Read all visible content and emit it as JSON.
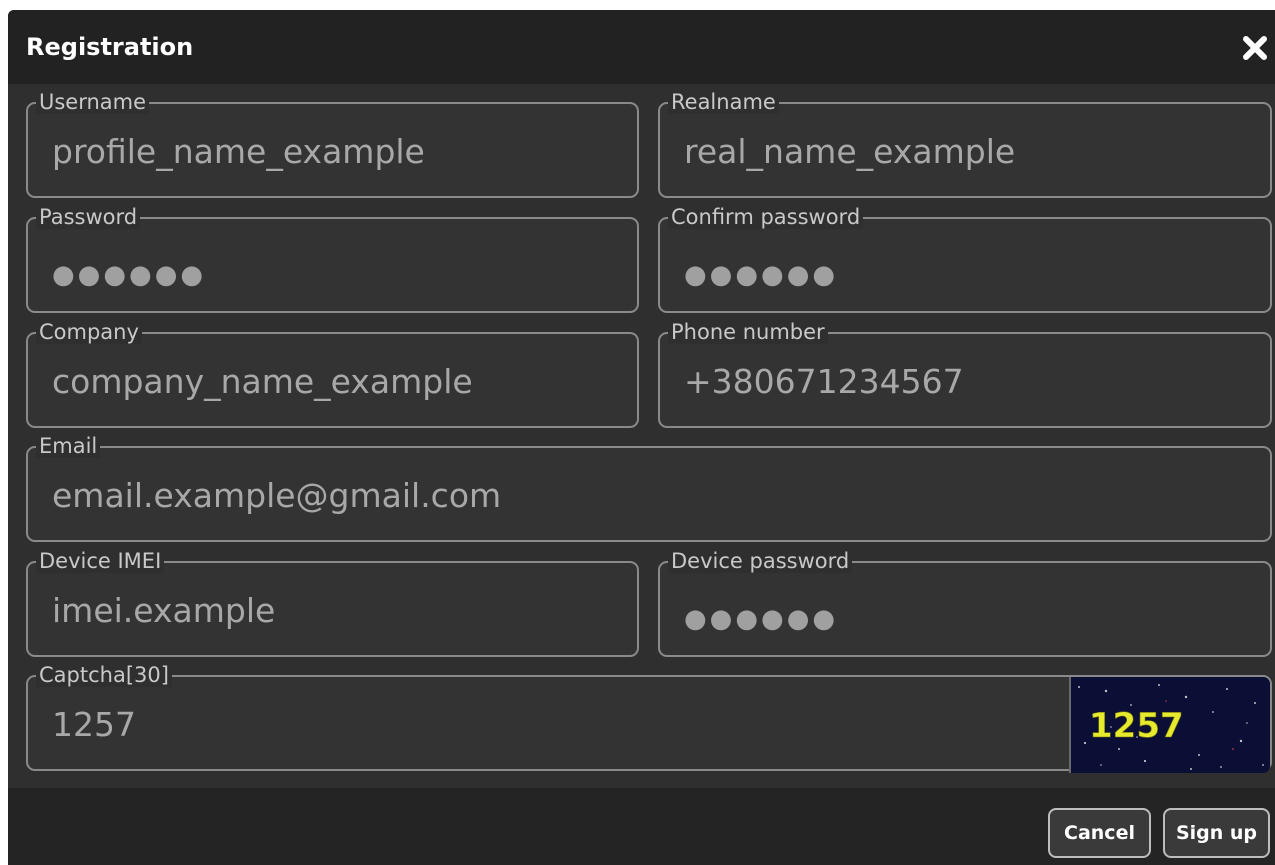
{
  "dialog": {
    "title": "Registration",
    "close_icon": "close-icon"
  },
  "fields": {
    "username": {
      "label": "Username",
      "value": "profile_name_example"
    },
    "realname": {
      "label": "Realname",
      "value": "real_name_example"
    },
    "password": {
      "label": "Password",
      "value": "●●●●●●"
    },
    "confirm_password": {
      "label": "Confirm password",
      "value": "●●●●●●"
    },
    "company": {
      "label": "Company",
      "value": "company_name_example"
    },
    "phone": {
      "label": "Phone number",
      "value": "+380671234567"
    },
    "email": {
      "label": "Email",
      "value": "email.example@gmail.com"
    },
    "imei": {
      "label": "Device IMEI",
      "value": "imei.example"
    },
    "device_password": {
      "label": "Device password",
      "value": "●●●●●●"
    },
    "captcha": {
      "label": "Captcha[30]",
      "value": "1257",
      "image_text": "1257"
    }
  },
  "buttons": {
    "cancel": "Cancel",
    "sign_up": "Sign up"
  },
  "colors": {
    "dialog_bg": "#2f2f2f",
    "titlebar_bg": "#222222",
    "field_border": "#8a8a8a",
    "label_text": "#c9c9c9",
    "value_text": "#a8a8a8",
    "captcha_text": "#e6ea2c",
    "captcha_bg": "#0c0f35"
  }
}
